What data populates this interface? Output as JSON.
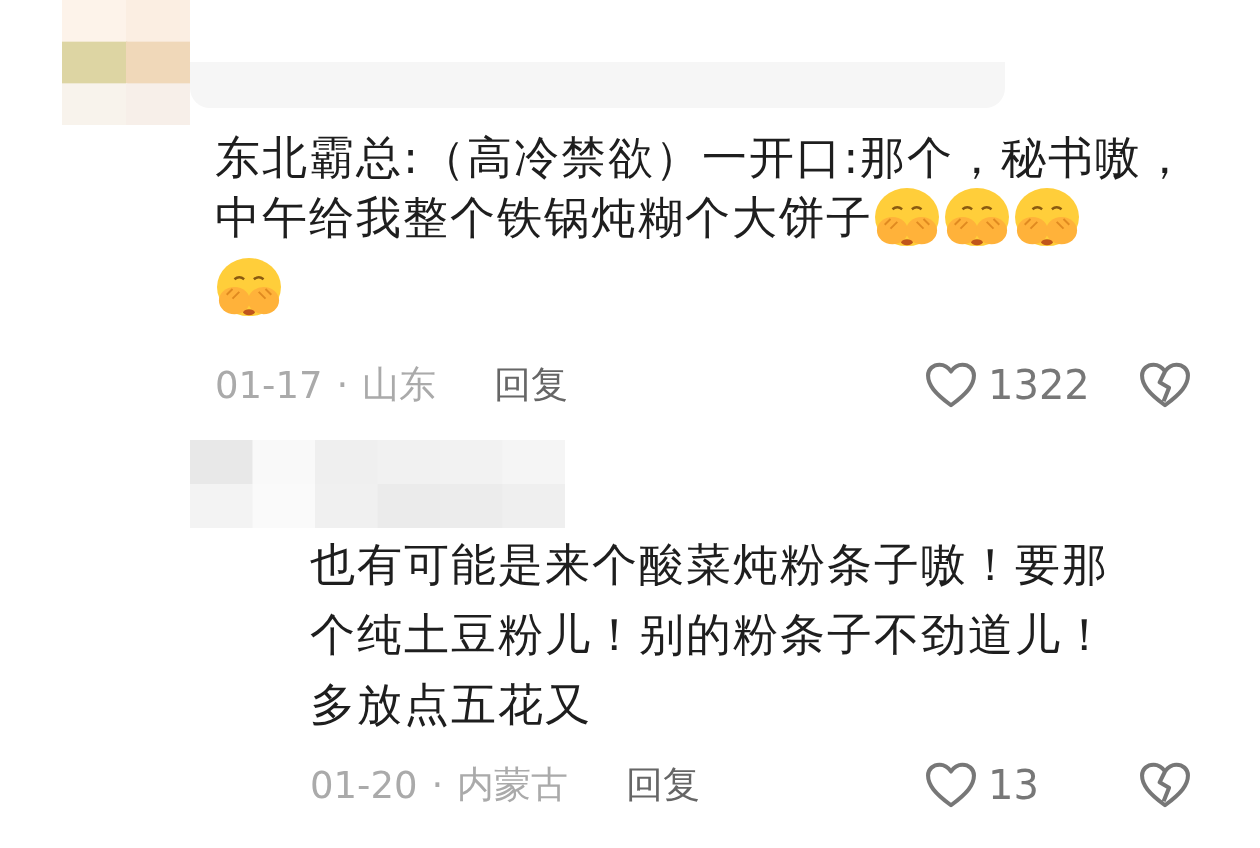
{
  "comments": [
    {
      "kind": "top",
      "lines": [
        {
          "text": "东北霸总:（高冷禁欲）一开口:那个，秘书嗷，"
        },
        {
          "text": "中午给我整个铁锅炖糊个大饼子",
          "emojis": [
            {
              "kind": "cover-face"
            },
            {
              "kind": "cover-face"
            },
            {
              "kind": "cover-face"
            }
          ]
        },
        {
          "emojis": [
            {
              "kind": "cover-face"
            }
          ]
        }
      ],
      "date": "01-17",
      "separator": "·",
      "location": "山东",
      "reply": "回复",
      "likes": "1322"
    },
    {
      "kind": "reply",
      "lines": [
        {
          "text": "也有可能是来个酸菜炖粉条子嗷！要那"
        },
        {
          "text": "个纯土豆粉儿！别的粉条子不劲道儿！"
        },
        {
          "text": "多放点五花又"
        }
      ],
      "date": "01-20",
      "separator": "·",
      "location": "内蒙古",
      "reply": "回复",
      "likes": "13"
    }
  ]
}
